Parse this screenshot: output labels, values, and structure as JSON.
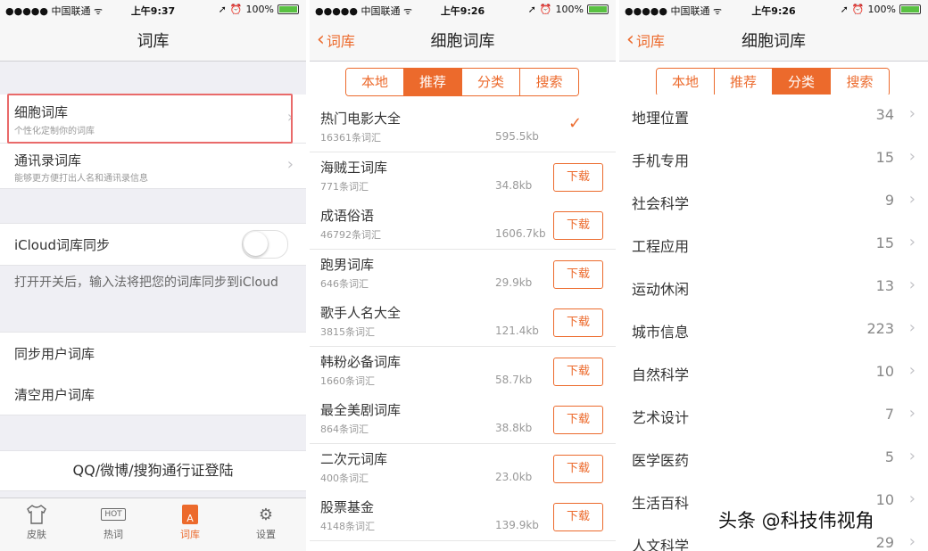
{
  "screen1": {
    "status": {
      "carrier": "●●●●● 中国联通 ᯤ",
      "time": "上午9:37",
      "battery": "100%"
    },
    "title": "词库",
    "cells": [
      {
        "main": "细胞词库",
        "sub": "个性化定制你的词库"
      },
      {
        "main": "通讯录词库",
        "sub": "能够更方便打出人名和通讯录信息"
      }
    ],
    "icloud_label": "iCloud词库同步",
    "icloud_on": false,
    "note": "打开开关后，输入法将把您的词库同步到iCloud",
    "actions": [
      "同步用户词库",
      "清空用户词库"
    ],
    "login": "QQ/微博/搜狗通行证登陆",
    "tabs": [
      {
        "label": "皮肤",
        "icon": "tshirt-icon"
      },
      {
        "label": "热词",
        "icon": "hot-icon",
        "icon_text": "HOT"
      },
      {
        "label": "词库",
        "icon": "dictionary-icon",
        "icon_text": "A",
        "active": true
      },
      {
        "label": "设置",
        "icon": "gear-icon"
      }
    ]
  },
  "screen2": {
    "status": {
      "carrier": "●●●●● 中国联通 ᯤ",
      "time": "上午9:26",
      "battery": "100%"
    },
    "back": "词库",
    "title": "细胞词库",
    "segments": [
      "本地",
      "推荐",
      "分类",
      "搜索"
    ],
    "active_segment": 1,
    "download_label": "下载",
    "items": [
      {
        "name": "热门电影大全",
        "count": "16361条词汇",
        "size": "595.5kb",
        "downloaded": true
      },
      {
        "name": "海贼王词库",
        "count": "771条词汇",
        "size": "34.8kb",
        "downloaded": false
      },
      {
        "name": "成语俗语",
        "count": "46792条词汇",
        "size": "1606.7kb",
        "downloaded": false
      },
      {
        "name": "跑男词库",
        "count": "646条词汇",
        "size": "29.9kb",
        "downloaded": false
      },
      {
        "name": "歌手人名大全",
        "count": "3815条词汇",
        "size": "121.4kb",
        "downloaded": false
      },
      {
        "name": "韩粉必备词库",
        "count": "1660条词汇",
        "size": "58.7kb",
        "downloaded": false
      },
      {
        "name": "最全美剧词库",
        "count": "864条词汇",
        "size": "38.8kb",
        "downloaded": false
      },
      {
        "name": "二次元词库",
        "count": "400条词汇",
        "size": "23.0kb",
        "downloaded": false
      },
      {
        "name": "股票基金",
        "count": "4148条词汇",
        "size": "139.9kb",
        "downloaded": false
      }
    ]
  },
  "screen3": {
    "status": {
      "carrier": "●●●●● 中国联通 ᯤ",
      "time": "上午9:26",
      "battery": "100%"
    },
    "back": "词库",
    "title": "细胞词库",
    "segments": [
      "本地",
      "推荐",
      "分类",
      "搜索"
    ],
    "active_segment": 2,
    "categories": [
      {
        "name": "地理位置",
        "count": "34"
      },
      {
        "name": "手机专用",
        "count": "15"
      },
      {
        "name": "社会科学",
        "count": "9"
      },
      {
        "name": "工程应用",
        "count": "15"
      },
      {
        "name": "运动休闲",
        "count": "13"
      },
      {
        "name": "城市信息",
        "count": "223"
      },
      {
        "name": "自然科学",
        "count": "10"
      },
      {
        "name": "艺术设计",
        "count": "7"
      },
      {
        "name": "医学医药",
        "count": "5"
      },
      {
        "name": "生活百科",
        "count": "10"
      },
      {
        "name": "人文科学",
        "count": "29"
      }
    ]
  },
  "watermark": "头条 @科技伟视角",
  "colors": {
    "accent": "#ec6a2c",
    "highlight_border": "#e96a6a",
    "background": "#efeff4"
  }
}
